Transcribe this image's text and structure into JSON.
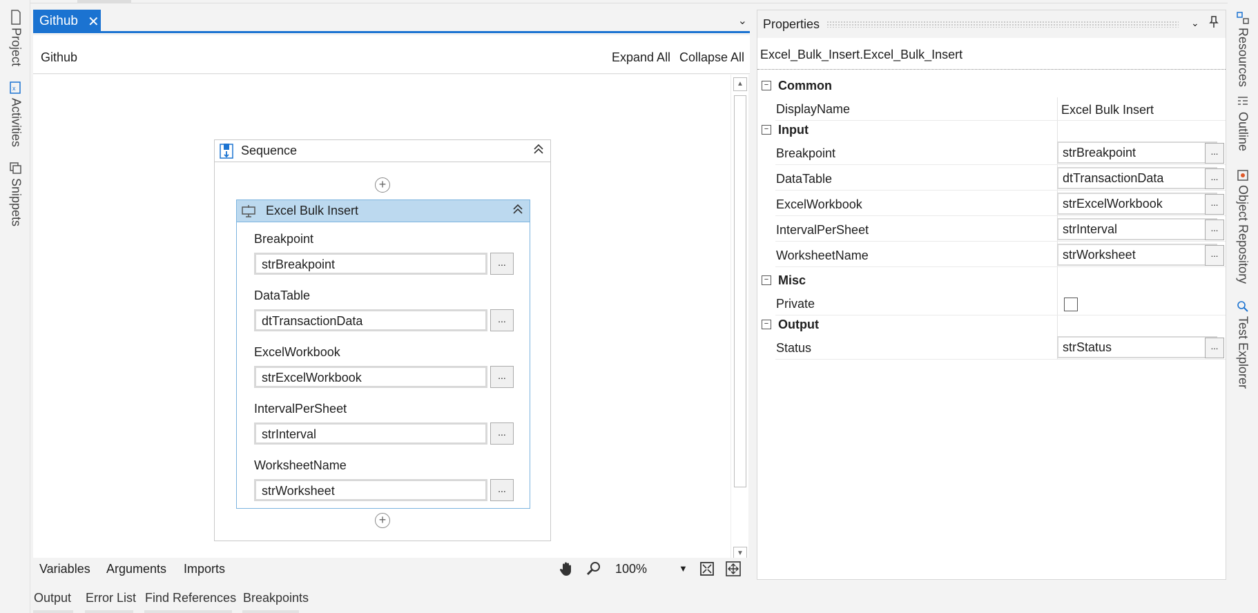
{
  "left_dock": {
    "project": "Project",
    "activities": "Activities",
    "snippets": "Snippets"
  },
  "right_dock": {
    "resources": "Resources",
    "outline": "Outline",
    "object_repository": "Object Repository",
    "test_explorer": "Test Explorer"
  },
  "doc_tab": {
    "label": "Github",
    "close": "✕",
    "menu": "⌄"
  },
  "breadcrumb": {
    "path": "Github",
    "expand_all": "Expand All",
    "collapse_all": "Collapse All"
  },
  "sequence": {
    "title": "Sequence",
    "activity": {
      "title": "Excel Bulk Insert",
      "fields": [
        {
          "label": "Breakpoint",
          "value": "strBreakpoint"
        },
        {
          "label": "DataTable",
          "value": "dtTransactionData"
        },
        {
          "label": "ExcelWorkbook",
          "value": "strExcelWorkbook"
        },
        {
          "label": "IntervalPerSheet",
          "value": "strInterval"
        },
        {
          "label": "WorksheetName",
          "value": "strWorksheet"
        }
      ],
      "ellipsis": "..."
    }
  },
  "designer_bar": {
    "variables": "Variables",
    "arguments": "Arguments",
    "imports": "Imports",
    "zoom": "100%"
  },
  "bottom_tabs": [
    "Output",
    "Error List",
    "Find References",
    "Breakpoints"
  ],
  "properties": {
    "title": "Properties",
    "subtitle": "Excel_Bulk_Insert.Excel_Bulk_Insert",
    "categories": {
      "common": {
        "name": "Common",
        "rows": [
          {
            "name": "DisplayName",
            "value": "Excel Bulk Insert"
          }
        ]
      },
      "input": {
        "name": "Input",
        "rows": [
          {
            "name": "Breakpoint",
            "value": "strBreakpoint"
          },
          {
            "name": "DataTable",
            "value": "dtTransactionData"
          },
          {
            "name": "ExcelWorkbook",
            "value": "strExcelWorkbook"
          },
          {
            "name": "IntervalPerSheet",
            "value": "strInterval"
          },
          {
            "name": "WorksheetName",
            "value": "strWorksheet"
          }
        ]
      },
      "misc": {
        "name": "Misc",
        "rows": [
          {
            "name": "Private",
            "checked": false
          }
        ]
      },
      "output": {
        "name": "Output",
        "rows": [
          {
            "name": "Status",
            "value": "strStatus"
          }
        ]
      }
    },
    "toggle_symbol": "−",
    "button_label": "..."
  },
  "colors": {
    "accent": "#1b73d1",
    "activity_header": "#bcd9ef",
    "activity_border": "#7ab3df"
  }
}
